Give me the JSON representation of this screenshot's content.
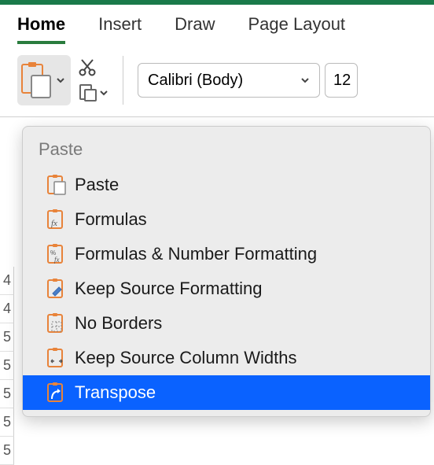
{
  "ribbon": {
    "tabs": [
      {
        "label": "Home",
        "active": true
      },
      {
        "label": "Insert",
        "active": false
      },
      {
        "label": "Draw",
        "active": false
      },
      {
        "label": "Page Layout",
        "active": false
      }
    ]
  },
  "font": {
    "family": "Calibri (Body)",
    "size": "12"
  },
  "paste_menu": {
    "header": "Paste",
    "items": [
      {
        "label": "Paste"
      },
      {
        "label": "Formulas"
      },
      {
        "label": "Formulas & Number Formatting"
      },
      {
        "label": "Keep Source Formatting"
      },
      {
        "label": "No Borders"
      },
      {
        "label": "Keep Source Column Widths"
      },
      {
        "label": "Transpose",
        "highlighted": true
      }
    ]
  },
  "rows": [
    "4",
    "4",
    "5",
    "5",
    "5",
    "5",
    "5"
  ]
}
